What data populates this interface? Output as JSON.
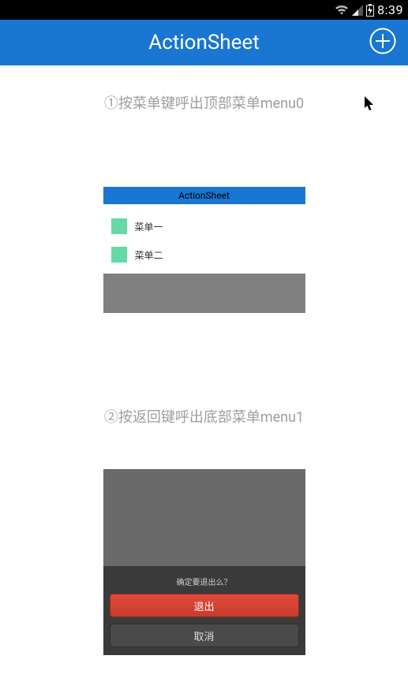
{
  "status": {
    "time": "8:39"
  },
  "appbar": {
    "title": "ActionSheet"
  },
  "section1": {
    "title": "①按菜单键呼出顶部菜单menu0",
    "header": "ActionSheet",
    "items": [
      {
        "label": "菜单一"
      },
      {
        "label": "菜单二"
      }
    ]
  },
  "section2": {
    "title": "②按返回键呼出底部菜单menu1",
    "sheet": {
      "prompt": "确定要退出么？",
      "exit": "退出",
      "cancel": "取消"
    }
  }
}
